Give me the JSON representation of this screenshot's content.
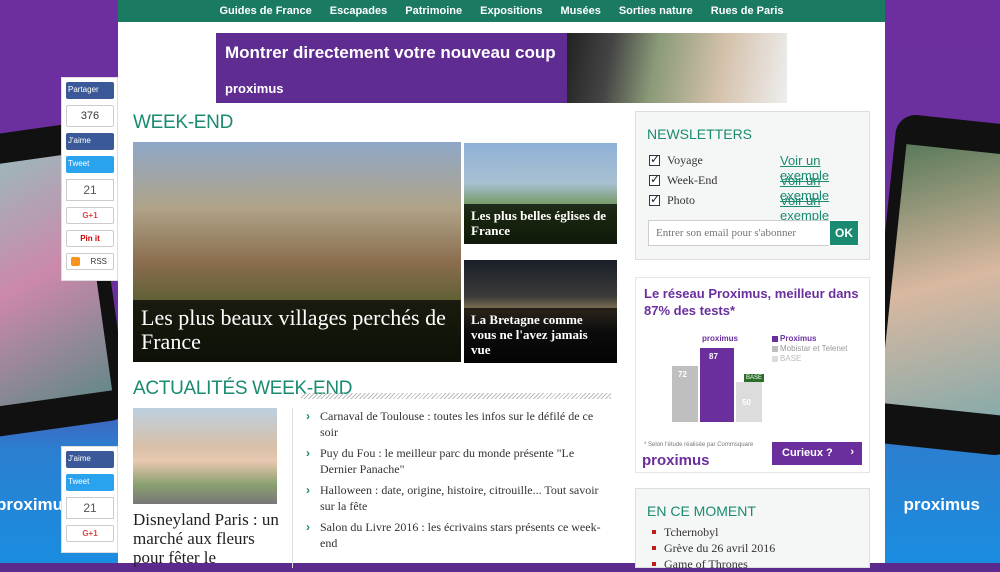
{
  "topnav": [
    "Guides de France",
    "Escapades",
    "Patrimoine",
    "Expositions",
    "Musées",
    "Sorties nature",
    "Rues de Paris"
  ],
  "banner": {
    "headline": "Montrer directement votre nouveau coup",
    "brand": "proximus"
  },
  "weekend": {
    "title": "WEEK-END",
    "tiles": [
      "Les plus beaux villages perchés de France",
      "Les plus belles églises de France",
      "La Bretagne comme vous ne l'avez jamais vue"
    ]
  },
  "actualites": {
    "title": "ACTUALITÉS WEEK-END",
    "feature_title": "Disneyland Paris : un marché aux fleurs pour fêter le",
    "items": [
      "Carnaval de Toulouse : toutes les infos sur le défilé de ce soir",
      "Puy du Fou : le meilleur parc du monde présente \"Le Dernier Panache\"",
      "Halloween : date, origine, histoire, citrouille... Tout savoir sur la fête",
      "Salon du Livre 2016 : les écrivains stars présents ce week-end"
    ]
  },
  "newsletters": {
    "title": "NEWSLETTERS",
    "options": [
      {
        "label": "Voyage",
        "link": "Voir un exemple"
      },
      {
        "label": "Week-End",
        "link": "Voir un exemple"
      },
      {
        "label": "Photo",
        "link": "Voir un exemple"
      }
    ],
    "email_placeholder": "Entrer son email pour s'abonner",
    "submit": "OK"
  },
  "ad": {
    "headline": "Le réseau Proximus, meilleur dans 87% des tests*",
    "bar_labels": [
      "72",
      "87",
      "50"
    ],
    "top_label": "proximus",
    "legend": [
      "Proximus",
      "Mobistar et Telenet",
      "BASE"
    ],
    "base_tag": "BASE",
    "note": "* Selon l'étude réalisée par Commsquare",
    "brand": "proximus",
    "cta": "Curieux ?",
    "colors": {
      "purple": "#6a2f9d",
      "grey": "#bfbfbf",
      "light": "#dcdcdc"
    }
  },
  "moment": {
    "title": "EN CE MOMENT",
    "items": [
      "Tchernobyl",
      "Grève du 26 avril 2016",
      "Game of Thrones"
    ]
  },
  "share_top": {
    "partager": "Partager",
    "likes": "376",
    "jaime": "J'aime",
    "tweet": "Tweet",
    "count": "21",
    "gplus": "G+1",
    "pin": "Pin it",
    "rss": "RSS"
  },
  "share_bottom": {
    "jaime": "J'aime",
    "tweet": "Tweet",
    "count": "21",
    "gplus": "G+1"
  },
  "side_brand": "proximus",
  "accent": "#1a8a70"
}
